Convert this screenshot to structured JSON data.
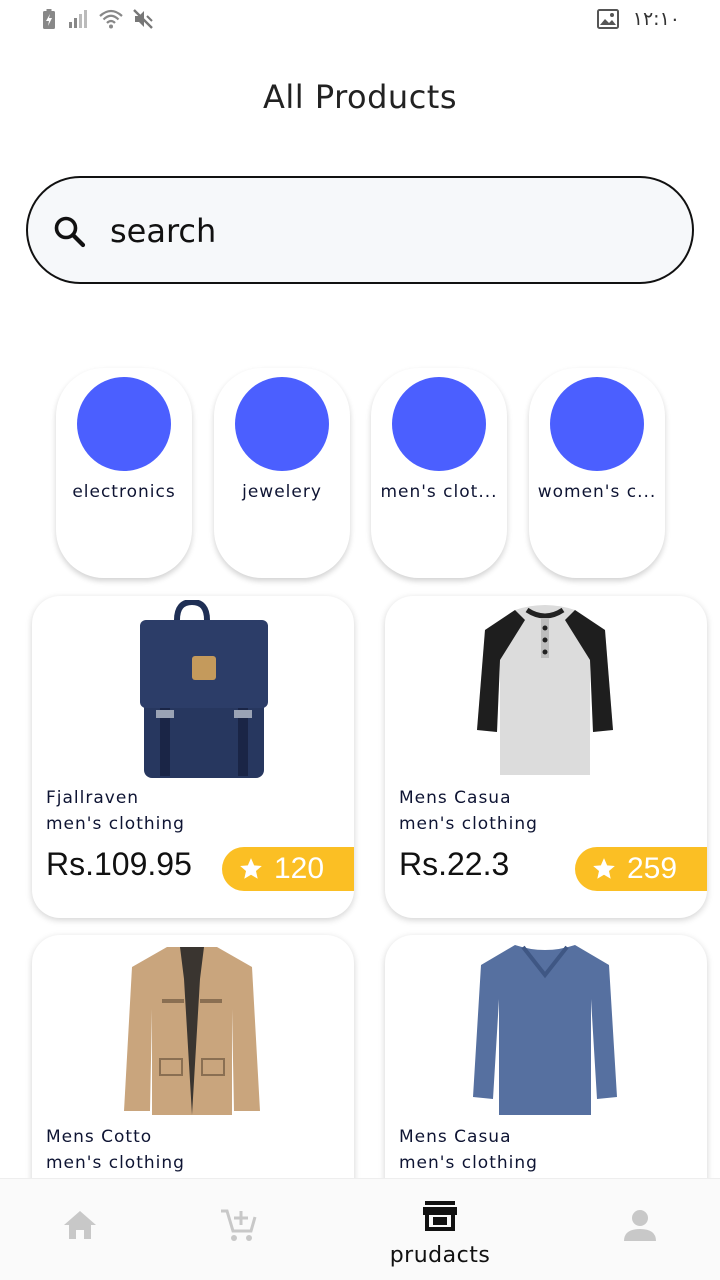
{
  "status_bar": {
    "time": "١٢:١٠",
    "icons": [
      "battery-charging-icon",
      "signal-icon",
      "wifi-icon",
      "mute-icon",
      "gallery-icon"
    ]
  },
  "page": {
    "title": "All Products"
  },
  "search": {
    "placeholder": "search",
    "icon": "search-icon"
  },
  "categories": [
    {
      "label": "electronics",
      "color": "#4b5fff"
    },
    {
      "label": "jewelery",
      "color": "#4b5fff"
    },
    {
      "label": "men's clot...",
      "color": "#4b5fff"
    },
    {
      "label": "women's c...",
      "color": "#4b5fff"
    }
  ],
  "products": [
    {
      "name": "Fjallraven",
      "category": "men's clothing",
      "price": "Rs.109.95",
      "rating": "120",
      "image": "backpack"
    },
    {
      "name": "Mens Casua",
      "category": "men's clothing",
      "price": "Rs.22.3",
      "rating": "259",
      "image": "raglan-tshirt"
    },
    {
      "name": "Mens Cotto",
      "category": "men's clothing",
      "price": "",
      "rating": "",
      "image": "jacket"
    },
    {
      "name": "Mens Casua",
      "category": "men's clothing",
      "price": "",
      "rating": "",
      "image": "long-sleeve-shirt"
    }
  ],
  "bottom_nav": {
    "items": [
      {
        "icon": "home-icon",
        "label": ""
      },
      {
        "icon": "add-cart-icon",
        "label": ""
      },
      {
        "icon": "store-icon",
        "label": "prudacts",
        "active": true
      },
      {
        "icon": "person-icon",
        "label": ""
      }
    ]
  },
  "colors": {
    "accent": "#4b5fff",
    "rating_badge": "#fbbf24",
    "nav_inactive": "#c8c8c8"
  }
}
